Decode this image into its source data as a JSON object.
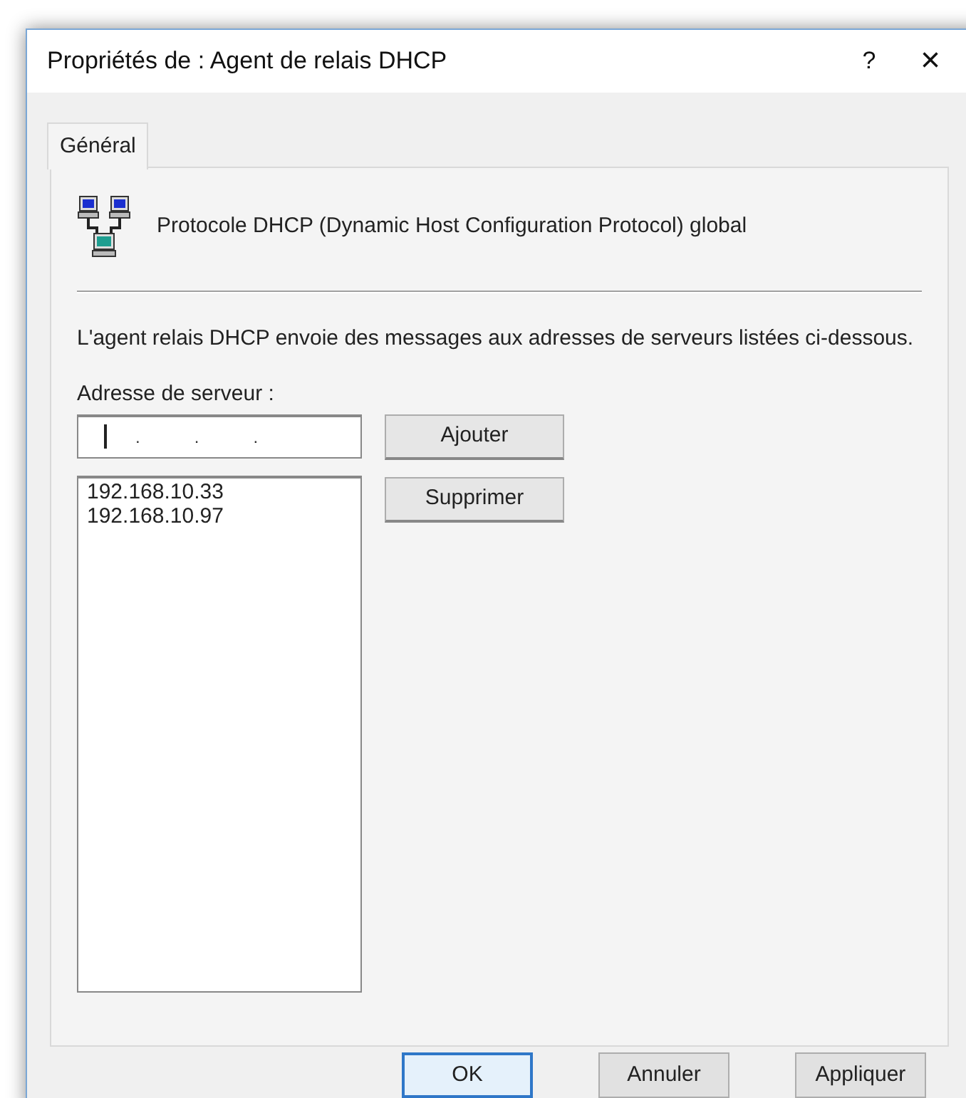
{
  "window": {
    "title": "Propriétés de : Agent de relais DHCP",
    "help": "?",
    "close": "×"
  },
  "tabs": [
    {
      "label": "Général",
      "selected": true
    }
  ],
  "header": {
    "text": "Protocole DHCP (Dynamic Host Configuration Protocol) global"
  },
  "description": "L'agent relais DHCP envoie des messages aux adresses de serveurs listées ci-dessous.",
  "server_address": {
    "label": "Adresse de serveur :",
    "separators": [
      ".",
      ".",
      "."
    ],
    "focused": true
  },
  "add_button": "Ajouter",
  "remove_button": "Supprimer",
  "servers": [
    {
      "address": "192.168.10.33"
    },
    {
      "address": "192.168.10.97"
    }
  ],
  "buttons": [
    {
      "label": "OK",
      "default": true
    },
    {
      "label": "Annuler",
      "default": false
    },
    {
      "label": "Appliquer",
      "default": false
    }
  ]
}
